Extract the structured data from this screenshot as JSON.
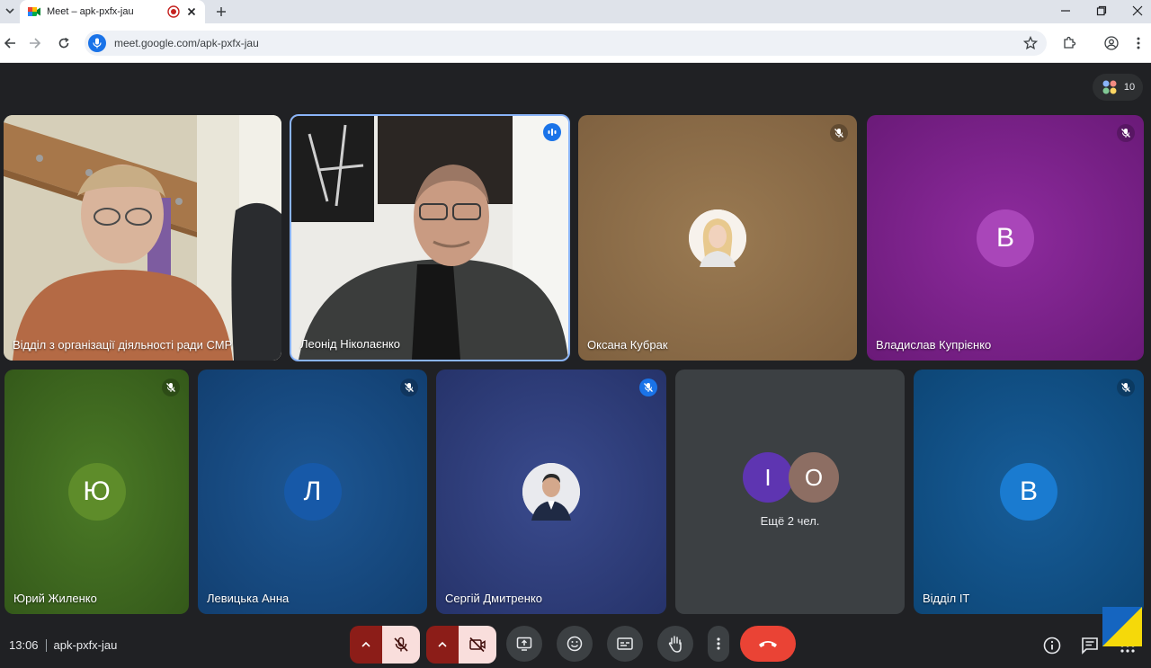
{
  "browser": {
    "tab_title": "Meet – apk-pxfx-jau",
    "url": "meet.google.com/apk-pxfx-jau"
  },
  "meet": {
    "participant_count": "10",
    "time": "13:06",
    "meeting_code": "apk-pxfx-jau",
    "tiles": [
      {
        "name": "Відділ з організації діяльності ради СМР",
        "type": "video"
      },
      {
        "name": "Леонід Ніколаєнко",
        "type": "video",
        "speaking": true
      },
      {
        "name": "Оксана Кубрак",
        "type": "photo-avatar",
        "muted": true,
        "bg": "#8a6a45"
      },
      {
        "name": "Владислав Купрієнко",
        "type": "letter-avatar",
        "letter": "В",
        "muted": true,
        "bg": "#7b1f8c",
        "avatar_bg": "#a142b5"
      },
      {
        "name": "Юрий Жиленко",
        "type": "letter-avatar",
        "letter": "Ю",
        "muted": true,
        "bg": "#3f6a1d",
        "avatar_bg": "#5e8c2a"
      },
      {
        "name": "Левицька Анна",
        "type": "letter-avatar",
        "letter": "Л",
        "muted": true,
        "bg": "#174a84",
        "avatar_bg": "#1a5aa8"
      },
      {
        "name": "Сергій Дмитренко",
        "type": "photo-avatar",
        "muted": true,
        "bg": "#2e3e78"
      },
      {
        "name": "",
        "type": "overflow",
        "letters": [
          "І",
          "О"
        ],
        "label": "Ещё 2 чел.",
        "bg": "#3c4043"
      },
      {
        "name": "Відділ IT",
        "type": "letter-avatar",
        "letter": "В",
        "muted": true,
        "bg": "#0f5088",
        "avatar_bg": "#1a73c8"
      }
    ]
  },
  "icons": {
    "favicon": "google-meet-icon",
    "record": "recording-icon",
    "mic": "mic-off-icon",
    "camera": "camera-off-icon",
    "present": "present-screen-icon",
    "reactions": "emoji-icon",
    "captions": "captions-icon",
    "hand": "raise-hand-icon",
    "more": "more-vert-icon",
    "end": "end-call-icon",
    "info": "info-icon",
    "chat": "chat-icon",
    "activities": "apps-icon"
  },
  "colors": {
    "end_call": "#ea4335",
    "muted_control_bg": "#f9dedc",
    "muted_control_arrow": "#8c1d18",
    "speaking_border": "#8ab4f8"
  }
}
